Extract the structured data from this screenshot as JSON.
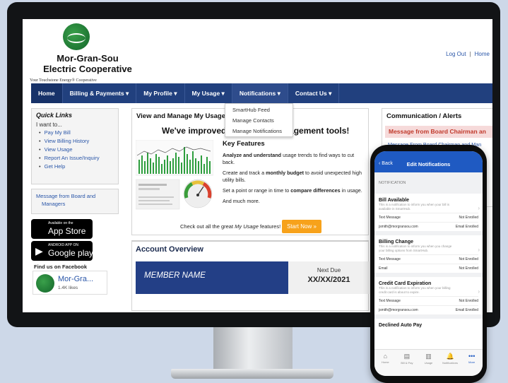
{
  "brand": {
    "name_line1": "Mor-Gran-Sou",
    "name_line2": "Electric Cooperative",
    "tagline": "Your Touchstone Energy® Cooperative"
  },
  "header_links": {
    "logout": "Log Out",
    "separator": "|",
    "home": "Home"
  },
  "nav": {
    "items": [
      {
        "label": "Home"
      },
      {
        "label": "Billing & Payments ▾"
      },
      {
        "label": "My Profile ▾"
      },
      {
        "label": "My Usage ▾"
      },
      {
        "label": "Notifications ▾"
      },
      {
        "label": "Contact Us ▾"
      }
    ],
    "dropdown": [
      "SmartHub Feed",
      "Manage Contacts",
      "Manage Notifications"
    ]
  },
  "quick_links": {
    "title": "Quick Links",
    "intro": "I want to...",
    "items": [
      "Pay My Bill",
      "View Billing History",
      "View Usage",
      "Report An Issue/Inquiry",
      "Get Help"
    ],
    "messages": [
      "Message from Board and Managers"
    ]
  },
  "stores": {
    "apple_small": "Available on the",
    "apple_big": "App Store",
    "google_small": "ANDROID APP ON",
    "google_big": "Google play"
  },
  "facebook": {
    "title": "Find us on Facebook",
    "name": "Mor-Gra...",
    "likes": "1.4K likes"
  },
  "usage_panel": {
    "title": "View and Manage My Usage",
    "headline": "We've improved our usage management tools!",
    "key_features_title": "Key Features",
    "features": [
      {
        "bold": "Analyze and understand",
        "rest": " usage trends to find ways to cut back."
      },
      {
        "pre": "Create and track a ",
        "bold": "monthly budget",
        "rest": " to avoid unexpected high utility bills."
      },
      {
        "pre": "Set a point or range in time to ",
        "bold": "compare differences",
        "rest": " in usage."
      },
      {
        "pre": "And much more.",
        "bold": "",
        "rest": ""
      }
    ],
    "checkout_pre": "Check out all the great ",
    "checkout_em": "My Usage",
    "checkout_post": " features!",
    "start_button": "Start Now »"
  },
  "account": {
    "title": "Account Overview",
    "member_name": "MEMBER NAME",
    "next_due_label": "Next Due",
    "next_due_value": "XX/XX/2021"
  },
  "communication": {
    "title": "Communication / Alerts",
    "alert_bar": "Message from Board Chairman an",
    "alert_link": "Message From Board Chairman and Man"
  },
  "phone": {
    "back": "‹ Back",
    "title": "Edit Notifications",
    "section": "NOTIFICATION",
    "groups": [
      {
        "title": "Bill Available",
        "desc": "This is a notification to inform you when your bill is available in SmartHub.",
        "rows": [
          [
            "Text Message",
            "Not Enrolled"
          ],
          [
            "jsmith@morgransou.com",
            "Email Enrolled"
          ]
        ]
      },
      {
        "title": "Billing Change",
        "desc": "This is a notification to inform you when you change your billing options from SmartHub.",
        "rows": [
          [
            "Text Message",
            "Not Enrolled"
          ],
          [
            "Email",
            "Not Enrolled"
          ]
        ]
      },
      {
        "title": "Credit Card Expiration",
        "desc": "This is a notification to inform you when your billing credit card is about to expire.",
        "rows": [
          [
            "Text Message",
            "Not Enrolled"
          ],
          [
            "jsmith@morgransou.com",
            "Email Enrolled"
          ]
        ]
      },
      {
        "title": "Declined Auto Pay",
        "desc": "",
        "rows": []
      }
    ],
    "tabs": [
      {
        "icon": "⌂",
        "label": "Home"
      },
      {
        "icon": "▤",
        "label": "Bill & Pay"
      },
      {
        "icon": "▥",
        "label": "Usage"
      },
      {
        "icon": "🔔",
        "label": "Notifications"
      },
      {
        "icon": "•••",
        "label": "More"
      }
    ]
  },
  "colors": {
    "nav": "#21407e",
    "member_bg": "#233f86",
    "start_button": "#f7a21b",
    "alert_bg": "#f6dada",
    "phone_header": "#1f5ac2"
  }
}
